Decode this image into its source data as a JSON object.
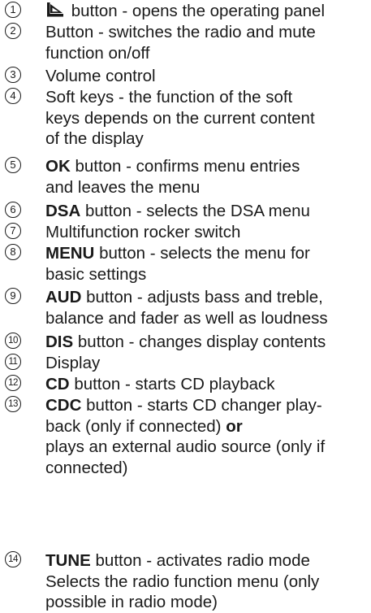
{
  "items": [
    {
      "num": "1",
      "lines": [
        "",
        "button - opens the operating panel"
      ],
      "key": "",
      "icon": "panel-open-icon"
    },
    {
      "num": "2",
      "lines": [
        "Button - switches the radio and mute",
        "function on/off"
      ]
    },
    {
      "num": "3",
      "lines": [
        "Volume control"
      ]
    },
    {
      "num": "4",
      "lines": [
        "Soft keys - the function of the soft",
        "keys depends on the current content",
        "of the display"
      ]
    },
    {
      "num": "5",
      "key": "OK",
      "lines": [
        "button - confirms menu entries",
        "and leaves the menu"
      ]
    },
    {
      "num": "6",
      "key": "DSA",
      "lines": [
        "button - selects the DSA menu"
      ]
    },
    {
      "num": "7",
      "lines": [
        "Multifunction rocker switch"
      ]
    },
    {
      "num": "8",
      "key": "MENU",
      "lines": [
        "button - selects the menu for",
        "basic settings"
      ]
    },
    {
      "num": "9",
      "key": "AUD",
      "lines": [
        "button - adjusts bass and treble,",
        "balance and fader as well as loudness"
      ]
    },
    {
      "num": "10",
      "key": "DIS",
      "lines": [
        "button - changes display contents"
      ]
    },
    {
      "num": "11",
      "lines": [
        "Display"
      ]
    },
    {
      "num": "12",
      "key": "CD",
      "lines": [
        "button - starts CD playback"
      ]
    },
    {
      "num": "13",
      "key": "CDC",
      "lines": [
        "button - starts CD changer play-",
        "back (only if connected)",
        "plays an external audio source (only if",
        "connected)"
      ],
      "or_word": "or"
    },
    {
      "num": "14",
      "key": "TUNE",
      "lines": [
        "button - activates radio mode",
        "Selects the radio function menu (only",
        "possible in radio mode)"
      ]
    }
  ]
}
